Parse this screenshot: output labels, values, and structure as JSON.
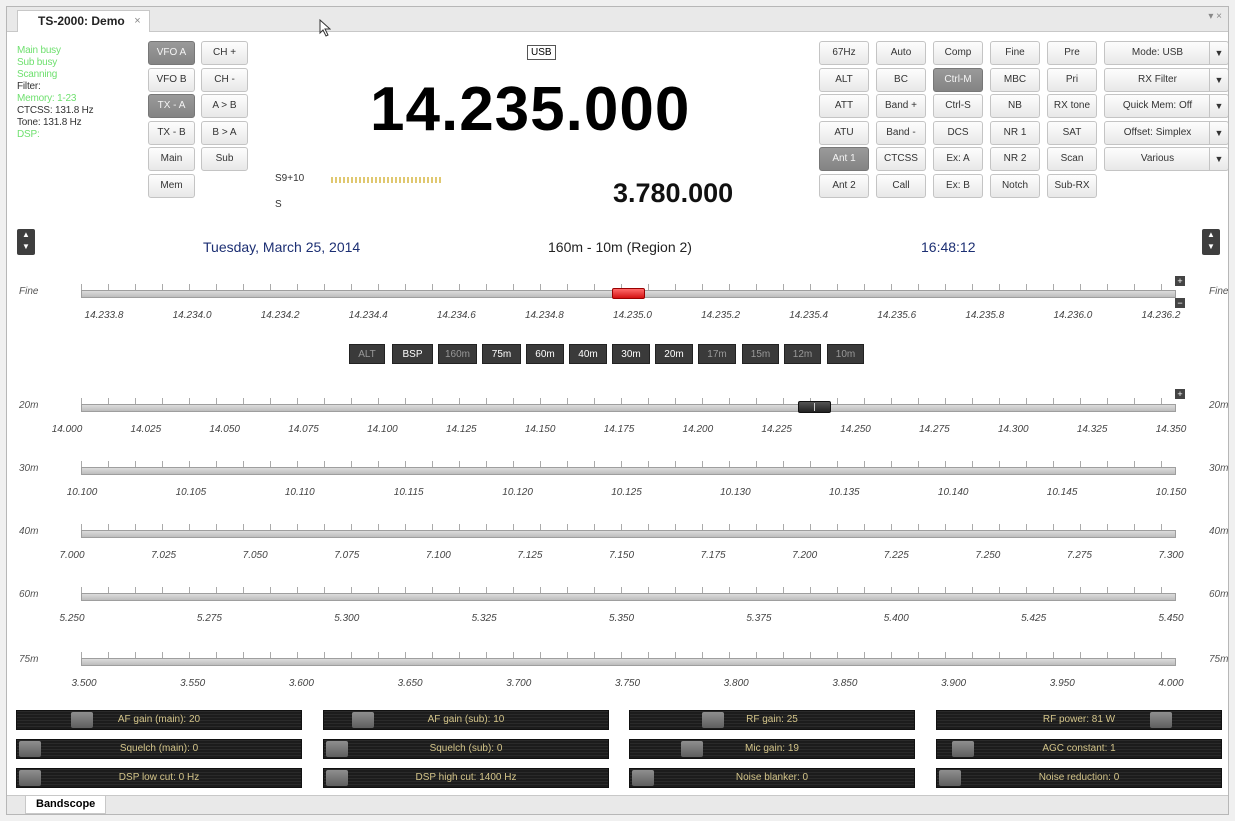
{
  "window": {
    "tab_title": "TS-2000: Demo",
    "tab_close": "×",
    "controls": "▾ ×"
  },
  "status_lines": [
    {
      "text": "Main busy",
      "color": "#6fe06f"
    },
    {
      "text": "Sub busy",
      "color": "#6fe06f"
    },
    {
      "text": "Scanning",
      "color": "#6fe06f"
    },
    {
      "text": "Filter:",
      "color": "#333333"
    },
    {
      "text": "Memory: 1-23",
      "color": "#6fe06f"
    },
    {
      "text": "CTCSS: 131.8 Hz",
      "color": "#333333"
    },
    {
      "text": "Tone: 131.8 Hz",
      "color": "#333333"
    },
    {
      "text": "DSP:",
      "color": "#6fe06f"
    }
  ],
  "left_buttons": [
    {
      "label": "VFO A",
      "on": true
    },
    {
      "label": "CH +",
      "on": false
    },
    {
      "label": "VFO B",
      "on": false
    },
    {
      "label": "CH -",
      "on": false
    },
    {
      "label": "TX - A",
      "on": true
    },
    {
      "label": "A > B",
      "on": false
    },
    {
      "label": "TX - B",
      "on": false
    },
    {
      "label": "B > A",
      "on": false
    },
    {
      "label": "Main",
      "on": false
    },
    {
      "label": "Sub",
      "on": false
    },
    {
      "label": "Mem",
      "on": false
    }
  ],
  "display": {
    "mode": "USB",
    "main_freq": "14.235.000",
    "sub_freq": "3.780.000",
    "smeter_value": "S9+10",
    "smeter_sub": "S"
  },
  "grid_buttons": [
    [
      "67Hz",
      "Auto",
      "Comp",
      "Fine",
      "Pre"
    ],
    [
      "ALT",
      "BC",
      "Ctrl-M",
      "MBC",
      "Pri"
    ],
    [
      "ATT",
      "Band +",
      "Ctrl-S",
      "NB",
      "RX tone"
    ],
    [
      "ATU",
      "Band -",
      "DCS",
      "NR 1",
      "SAT"
    ],
    [
      "Ant 1",
      "CTCSS",
      "Ex: A",
      "NR 2",
      "Scan"
    ],
    [
      "Ant 2",
      "Call",
      "Ex: B",
      "Notch",
      "Sub-RX"
    ]
  ],
  "grid_on": [
    "Ctrl-M",
    "Ant 1"
  ],
  "dropdowns": [
    "Mode: USB",
    "RX Filter",
    "Quick Mem: Off",
    "Offset: Simplex",
    "Various"
  ],
  "info_bar": {
    "date": "Tuesday, March 25, 2014",
    "band_range": "160m - 10m (Region 2)",
    "time": "16:48:12"
  },
  "fine_row": {
    "label": "Fine",
    "ticks": [
      "14.233.8",
      "14.234.0",
      "14.234.2",
      "14.234.4",
      "14.234.6",
      "14.234.8",
      "14.235.0",
      "14.235.2",
      "14.235.4",
      "14.235.6",
      "14.235.8",
      "14.236.0",
      "14.236.2"
    ]
  },
  "band_buttons": [
    {
      "label": "ALT",
      "dim": true
    },
    {
      "label": "BSP",
      "dim": false
    },
    {
      "label": "160m",
      "dim": true
    },
    {
      "label": "75m",
      "dim": false
    },
    {
      "label": "60m",
      "dim": false
    },
    {
      "label": "40m",
      "dim": false
    },
    {
      "label": "30m",
      "dim": false
    },
    {
      "label": "20m",
      "dim": false
    },
    {
      "label": "17m",
      "dim": true
    },
    {
      "label": "15m",
      "dim": true
    },
    {
      "label": "12m",
      "dim": true
    },
    {
      "label": "10m",
      "dim": true
    }
  ],
  "bands": [
    {
      "label": "20m",
      "ticks": [
        "14.000",
        "14.025",
        "14.050",
        "14.075",
        "14.100",
        "14.125",
        "14.150",
        "14.175",
        "14.200",
        "14.225",
        "14.250",
        "14.275",
        "14.300",
        "14.325",
        "14.350"
      ]
    },
    {
      "label": "30m",
      "ticks": [
        "10.100",
        "10.105",
        "10.110",
        "10.115",
        "10.120",
        "10.125",
        "10.130",
        "10.135",
        "10.140",
        "10.145",
        "10.150"
      ]
    },
    {
      "label": "40m",
      "ticks": [
        "7.000",
        "7.025",
        "7.050",
        "7.075",
        "7.100",
        "7.125",
        "7.150",
        "7.175",
        "7.200",
        "7.225",
        "7.250",
        "7.275",
        "7.300"
      ]
    },
    {
      "label": "60m",
      "ticks": [
        "5.250",
        "5.275",
        "5.300",
        "5.325",
        "5.350",
        "5.375",
        "5.400",
        "5.425",
        "5.450"
      ]
    },
    {
      "label": "75m",
      "ticks": [
        "3.500",
        "3.550",
        "3.600",
        "3.650",
        "3.700",
        "3.750",
        "3.800",
        "3.850",
        "3.900",
        "3.950",
        "4.000"
      ]
    }
  ],
  "sliders": [
    {
      "label": "AF gain (main): 20",
      "level": 0.2
    },
    {
      "label": "AF gain (sub): 10",
      "level": 0.1
    },
    {
      "label": "RF gain: 25",
      "level": 0.27
    },
    {
      "label": "RF power: 81 W",
      "level": 0.81
    },
    {
      "label": "Squelch (main): 0",
      "level": 0
    },
    {
      "label": "Squelch (sub): 0",
      "level": 0
    },
    {
      "label": "Mic gain: 19",
      "level": 0.19
    },
    {
      "label": "AGC constant: 1",
      "level": 0.05
    },
    {
      "label": "DSP low cut: 0 Hz",
      "level": 0
    },
    {
      "label": "DSP high cut: 1400 Hz",
      "level": 0
    },
    {
      "label": "Noise blanker: 0",
      "level": 0
    },
    {
      "label": "Noise reduction: 0",
      "level": 0
    }
  ],
  "bottom_tab": "Bandscope"
}
